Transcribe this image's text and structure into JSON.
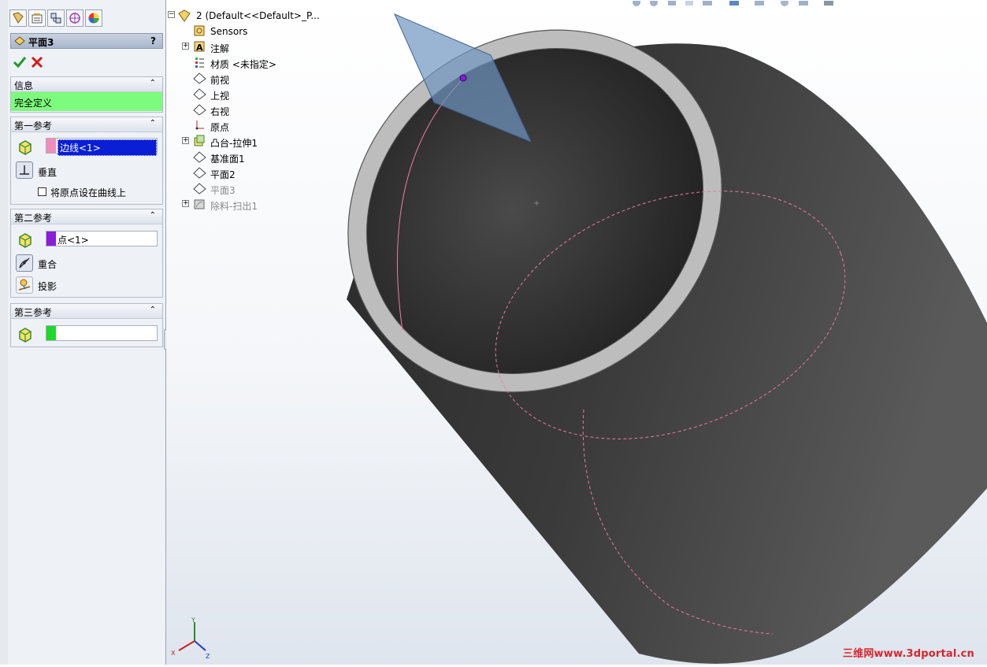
{
  "property_manager": {
    "title": "平面3",
    "help": "?",
    "message_group": {
      "title": "信息",
      "status": "完全定义",
      "status_color": "#7dfb7d"
    },
    "first_reference": {
      "title": "第一参考",
      "selection": "边线<1>",
      "selection_color": "#f28cba",
      "constraint": "垂直",
      "checkbox_label": "将原点设在曲线上"
    },
    "second_reference": {
      "title": "第二参考",
      "selection": "点<1>",
      "selection_color": "#8a1cd8",
      "constraint_1": "重合",
      "constraint_2": "投影"
    },
    "third_reference": {
      "title": "第三参考",
      "selection": "",
      "selection_color": "#1ed82a"
    }
  },
  "feature_tree": {
    "root": "2  (Default<<Default>_P...",
    "items": [
      {
        "label": "Sensors",
        "icon": "sensor-icon",
        "expandable": false,
        "dim": false
      },
      {
        "label": "注解",
        "icon": "annotation-icon",
        "expandable": true,
        "dim": false
      },
      {
        "label": "材质 <未指定>",
        "icon": "material-icon",
        "expandable": false,
        "dim": false
      },
      {
        "label": "前视",
        "icon": "plane-icon",
        "expandable": false,
        "dim": false
      },
      {
        "label": "上视",
        "icon": "plane-icon",
        "expandable": false,
        "dim": false
      },
      {
        "label": "右视",
        "icon": "plane-icon",
        "expandable": false,
        "dim": false
      },
      {
        "label": "原点",
        "icon": "origin-icon",
        "expandable": false,
        "dim": false
      },
      {
        "label": "凸台-拉伸1",
        "icon": "extrude-icon",
        "expandable": true,
        "dim": false
      },
      {
        "label": "基准面1",
        "icon": "plane-icon",
        "expandable": false,
        "dim": false
      },
      {
        "label": "平面2",
        "icon": "plane-icon",
        "expandable": false,
        "dim": false
      },
      {
        "label": "平面3",
        "icon": "plane-icon",
        "expandable": false,
        "dim": true
      },
      {
        "label": "除料-扫出1",
        "icon": "sweep-cut-icon",
        "expandable": true,
        "dim": true
      }
    ]
  },
  "triad": {
    "x": "X",
    "y": "Y",
    "z": "Z"
  },
  "watermark": "三维网www.3dportal.cn"
}
